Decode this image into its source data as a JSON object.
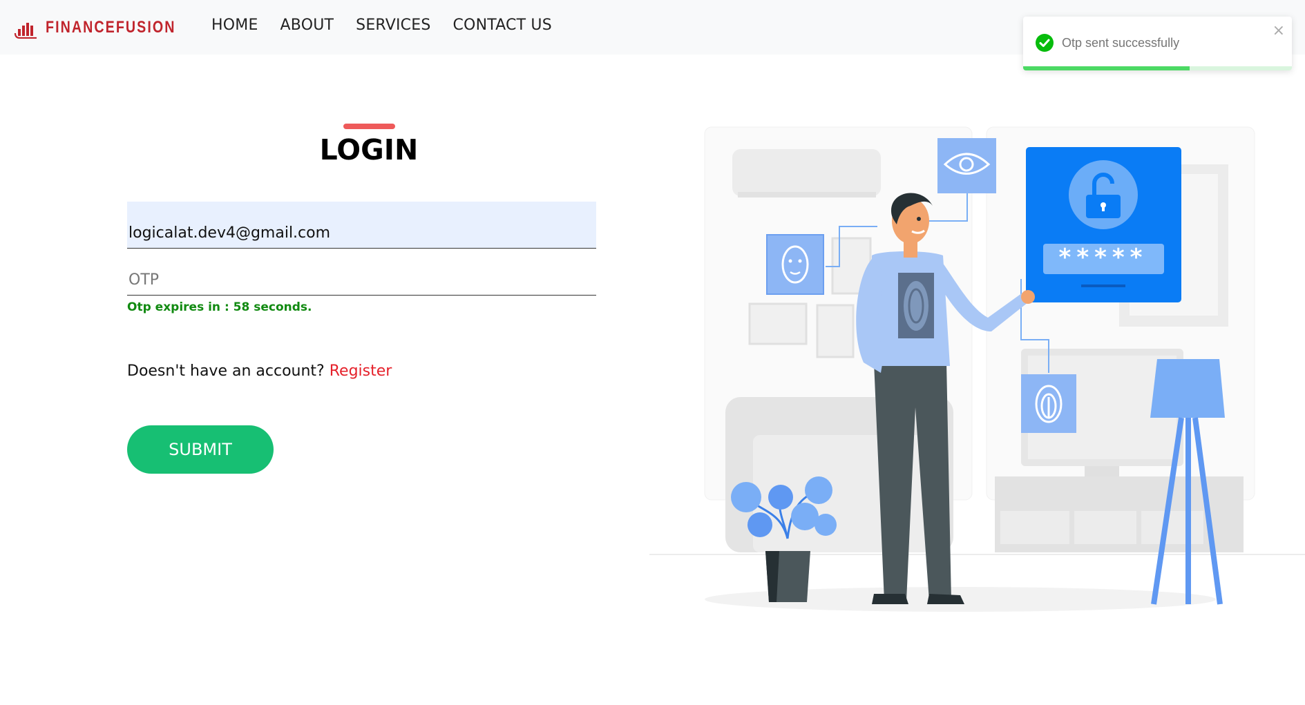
{
  "navbar": {
    "brand": "FINANCEFUSION",
    "links": [
      "HOME",
      "ABOUT",
      "SERVICES",
      "CONTACT US"
    ]
  },
  "toast": {
    "message": "Otp sent successfully",
    "close_label": "×",
    "progress_fraction": 0.62,
    "icon": "check-circle-icon"
  },
  "login": {
    "title": "LOGIN",
    "email_value": "logicalat.dev4@gmail.com",
    "otp_placeholder": "OTP",
    "otp_value": "",
    "otp_timer": "Otp expires in : 58 seconds.",
    "register_prompt": "Doesn't have an account?",
    "register_link": "Register",
    "submit_label": "SUBMIT"
  },
  "colors": {
    "brand": "#c0242c",
    "accent_bar": "#ee5a5a",
    "submit": "#17bf73",
    "link": "#e5202a",
    "timer": "#118a11",
    "illustration_blue": "#0a7cf5"
  }
}
